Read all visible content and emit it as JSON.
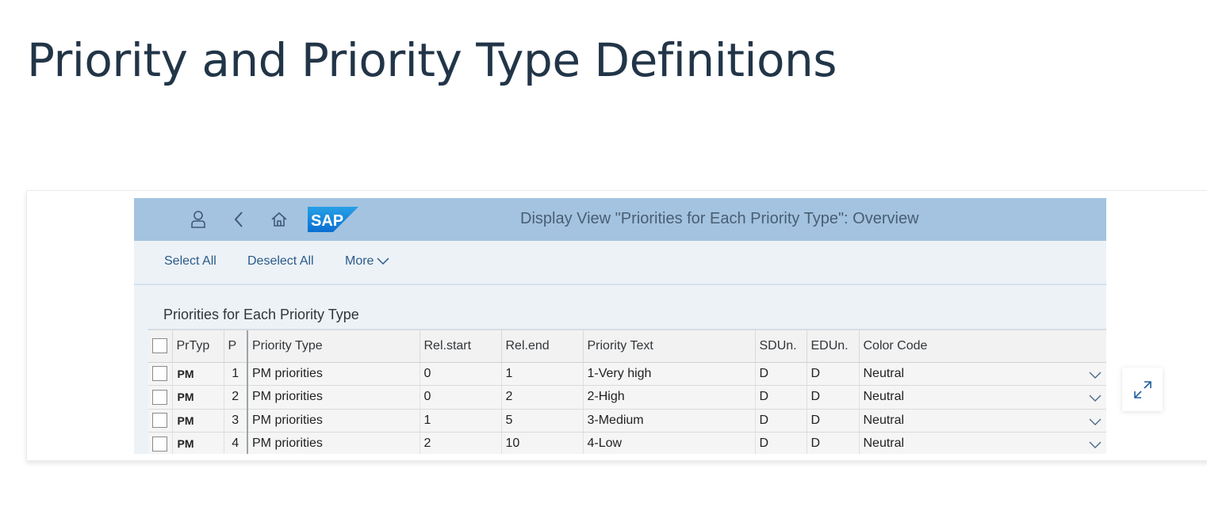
{
  "page": {
    "title": "Priority and Priority Type Definitions"
  },
  "shell": {
    "title": "Display View \"Priorities for Each Priority Type\": Overview",
    "logo_text": "SAP",
    "icons": [
      "user-icon",
      "back-icon",
      "home-icon"
    ]
  },
  "toolbar": {
    "select_all": "Select All",
    "deselect_all": "Deselect All",
    "more": "More"
  },
  "section": {
    "title": "Priorities for Each Priority Type"
  },
  "table": {
    "columns": [
      "PrTyp",
      "P",
      "Priority Type",
      "Rel.start",
      "Rel.end",
      "Priority Text",
      "SDUn.",
      "EDUn.",
      "Color Code"
    ],
    "rows": [
      {
        "prtyp": "PM",
        "p": "1",
        "priority_type": "PM priorities",
        "rel_start": "0",
        "rel_end": "1",
        "priority_text": "1-Very high",
        "sdun": "D",
        "edun": "D",
        "color_code": "Neutral"
      },
      {
        "prtyp": "PM",
        "p": "2",
        "priority_type": "PM priorities",
        "rel_start": "0",
        "rel_end": "2",
        "priority_text": "2-High",
        "sdun": "D",
        "edun": "D",
        "color_code": "Neutral"
      },
      {
        "prtyp": "PM",
        "p": "3",
        "priority_type": "PM priorities",
        "rel_start": "1",
        "rel_end": "5",
        "priority_text": "3-Medium",
        "sdun": "D",
        "edun": "D",
        "color_code": "Neutral"
      },
      {
        "prtyp": "PM",
        "p": "4",
        "priority_type": "PM priorities",
        "rel_start": "2",
        "rel_end": "10",
        "priority_text": "4-Low",
        "sdun": "D",
        "edun": "D",
        "color_code": "Neutral"
      }
    ]
  },
  "colors": {
    "shellbar": "#a3c3e0",
    "window_bg": "#edf2f7",
    "link": "#2a5a8a",
    "title": "#223548"
  },
  "expand": {
    "icon": "expand-icon"
  }
}
